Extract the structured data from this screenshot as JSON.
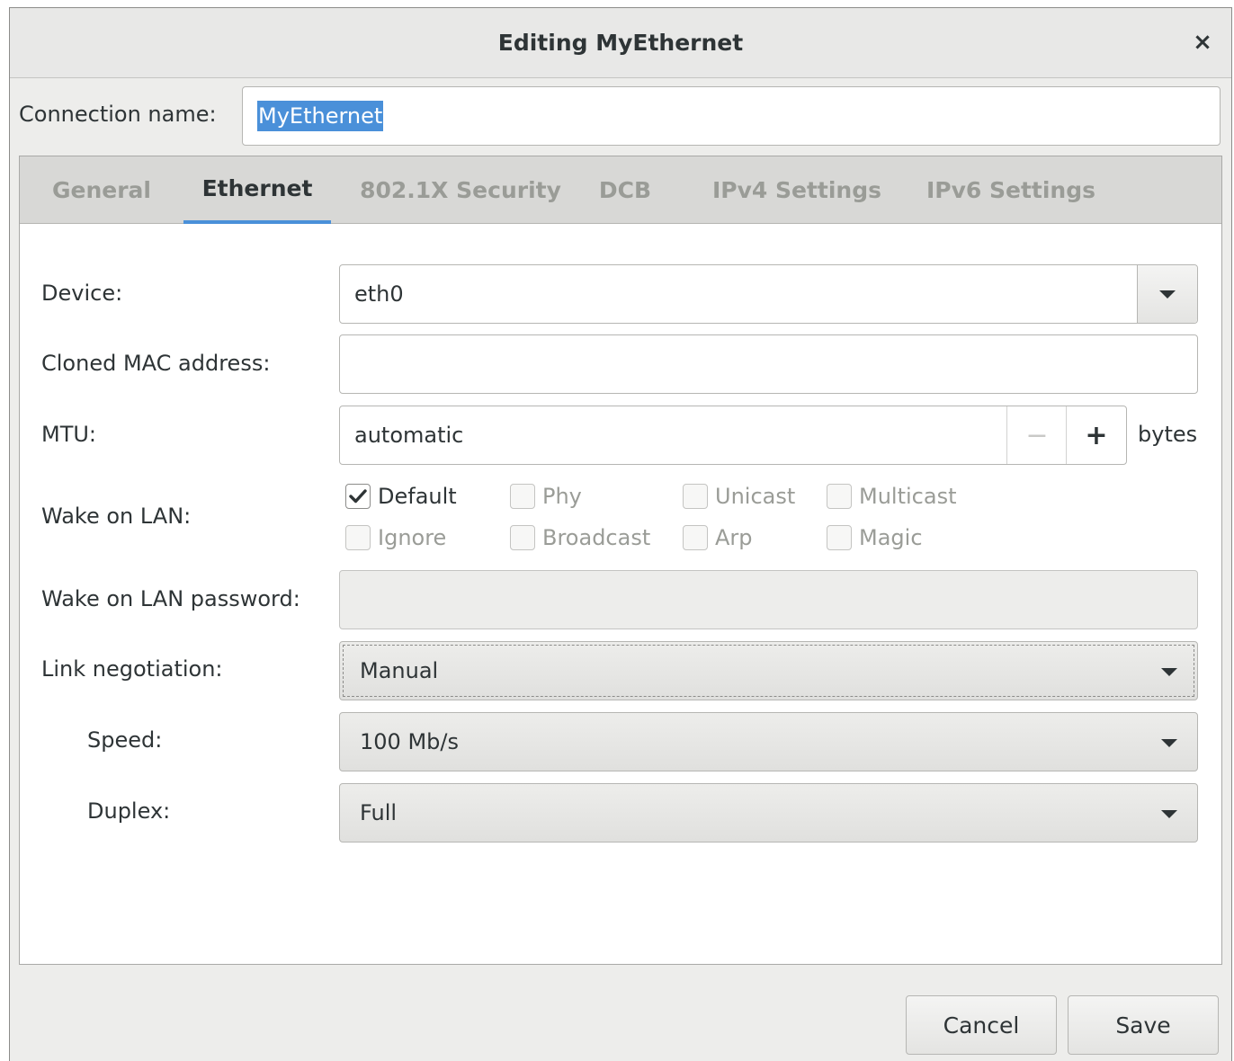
{
  "window": {
    "title": "Editing MyEthernet",
    "close_glyph": "×"
  },
  "connection": {
    "label": "Connection name:",
    "value": "MyEthernet"
  },
  "tabs": [
    {
      "label": "General",
      "active": false
    },
    {
      "label": "Ethernet",
      "active": true
    },
    {
      "label": "802.1X Security",
      "active": false
    },
    {
      "label": "DCB",
      "active": false
    },
    {
      "label": "IPv4 Settings",
      "active": false
    },
    {
      "label": "IPv6 Settings",
      "active": false
    }
  ],
  "ethernet": {
    "device": {
      "label": "Device:",
      "value": "eth0"
    },
    "cloned_mac": {
      "label": "Cloned MAC address:",
      "value": ""
    },
    "mtu": {
      "label": "MTU:",
      "value": "automatic",
      "minus": "−",
      "plus": "+",
      "unit": "bytes"
    },
    "wake_on_lan": {
      "label": "Wake on LAN:",
      "options": [
        {
          "label": "Default",
          "checked": true
        },
        {
          "label": "Phy",
          "checked": false
        },
        {
          "label": "Unicast",
          "checked": false
        },
        {
          "label": "Multicast",
          "checked": false
        },
        {
          "label": "Ignore",
          "checked": false
        },
        {
          "label": "Broadcast",
          "checked": false
        },
        {
          "label": "Arp",
          "checked": false
        },
        {
          "label": "Magic",
          "checked": false
        }
      ]
    },
    "wol_password": {
      "label": "Wake on LAN password:",
      "value": ""
    },
    "link_negotiation": {
      "label": "Link negotiation:",
      "value": "Manual"
    },
    "speed": {
      "label": "Speed:",
      "value": "100 Mb/s"
    },
    "duplex": {
      "label": "Duplex:",
      "value": "Full"
    }
  },
  "buttons": {
    "cancel": "Cancel",
    "save": "Save"
  },
  "colors": {
    "accent": "#4a90d9",
    "selection": "#4a90d9"
  },
  "icons": {
    "close": "close-icon",
    "dropdown": "chevron-down-icon",
    "check": "checkmark-icon"
  }
}
